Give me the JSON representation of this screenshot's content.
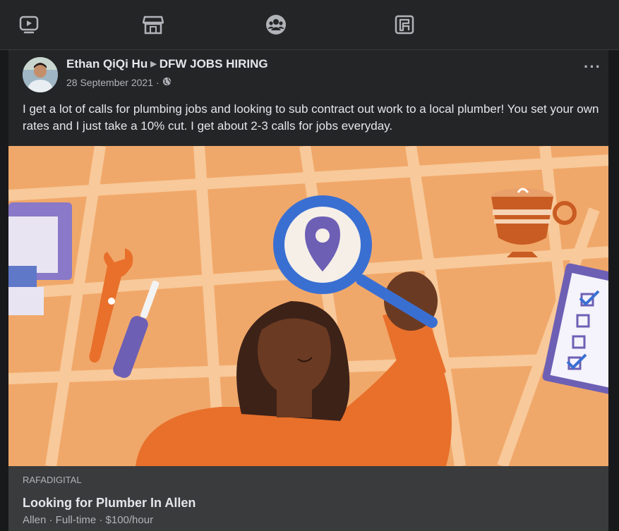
{
  "nav": {
    "items": [
      {
        "icon": "video-icon"
      },
      {
        "icon": "marketplace-icon"
      },
      {
        "icon": "groups-icon"
      },
      {
        "icon": "gaming-icon"
      }
    ]
  },
  "post": {
    "author": "Ethan QiQi Hu",
    "group": "DFW JOBS HIRING",
    "date": "28 September 2021",
    "separator": "·",
    "more": "···",
    "text": "I get a lot of calls for plumbing jobs and looking to sub contract out work to a local plumber! You set your own rates and I just take a 10% cut. I get about 2-3 calls for jobs everyday.",
    "image": {
      "icon": "woman-with-magnifying-glass-map-illustration"
    },
    "link": {
      "source": "RAFADIGITAL",
      "title": "Looking for Plumber In Allen",
      "subtitle": "Allen · Full-time · $100/hour"
    }
  },
  "colors": {
    "background": "#18191a",
    "card": "#242526",
    "link_card": "#3a3b3c",
    "illustration_orange": "#f0a86a"
  }
}
